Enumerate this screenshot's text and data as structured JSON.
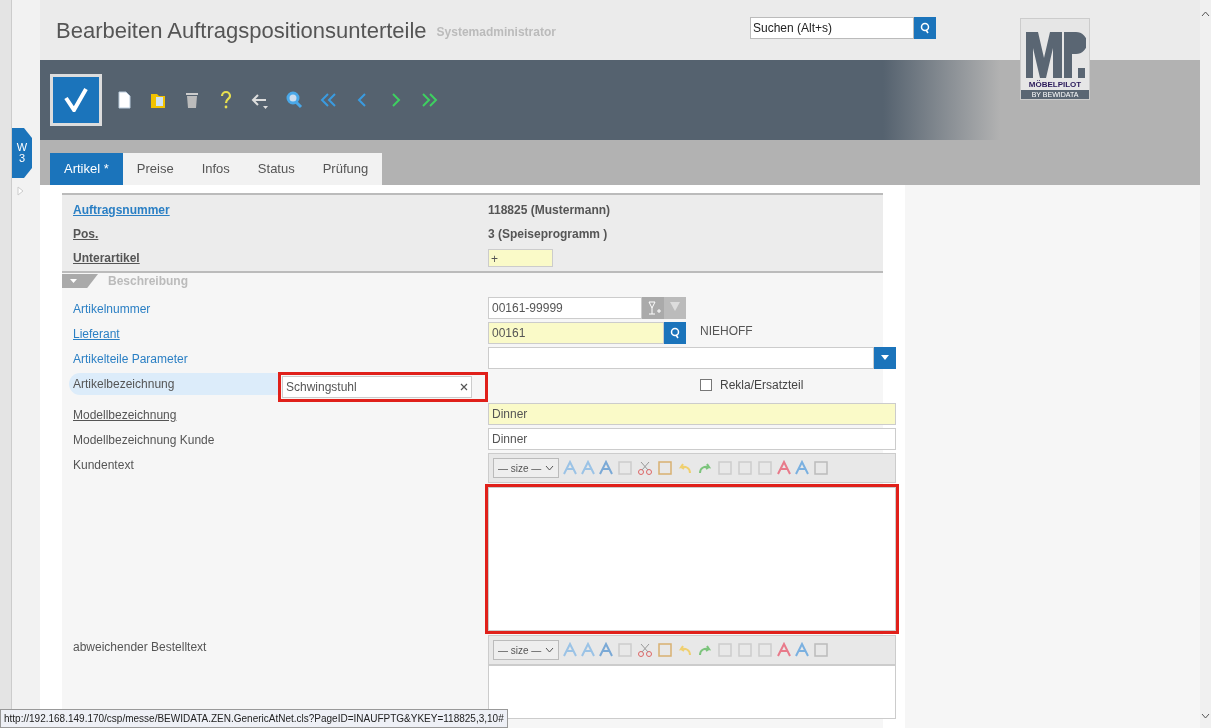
{
  "header": {
    "title": "Bearbeiten Auftragspositionsunterteile",
    "user": "Systemadministrator",
    "search": {
      "placeholder": "Suchen (Alt+s)"
    },
    "logo": {
      "brand": "MÖBELPILOT",
      "sub": "BY BEWIDATA"
    }
  },
  "side_tab": {
    "label": "W 3"
  },
  "tabs": [
    {
      "label": "Artikel *",
      "selected": true
    },
    {
      "label": "Preise",
      "selected": false
    },
    {
      "label": "Infos",
      "selected": false
    },
    {
      "label": "Status",
      "selected": false
    },
    {
      "label": "Prüfung",
      "selected": false
    }
  ],
  "summary": [
    {
      "label": "Auftragsnummer",
      "link": true,
      "value": "118825 (Mustermann)",
      "kind": "text"
    },
    {
      "label": "Pos.",
      "link": false,
      "value": "3 (Speiseprogramm )",
      "kind": "text"
    },
    {
      "label": "Unterartikel",
      "link": false,
      "value": "+",
      "kind": "input"
    }
  ],
  "section": {
    "title": "Beschreibung",
    "expanded": true
  },
  "fields": [
    {
      "label": "Artikelnummer",
      "color": "#2a7fc4",
      "underlined": false,
      "focused": false,
      "kind": "article",
      "value": "00161-99999"
    },
    {
      "label": "Lieferant",
      "color": "#2a7fc4",
      "underlined": true,
      "focused": false,
      "kind": "lookup",
      "value": "00161",
      "extra": "NIEHOFF"
    },
    {
      "label": "Artikelteile Parameter",
      "color": "#2a7fc4",
      "underlined": false,
      "focused": false,
      "kind": "select"
    },
    {
      "label": "Artikelbezeichnung",
      "color": "#555555",
      "underlined": false,
      "focused": true,
      "kind": "side",
      "value": "Schwingstuhl",
      "highlighted": true,
      "checkbox": {
        "label": "Rekla/Ersatzteil",
        "checked": false
      }
    },
    {
      "label": "Modellbezeichnung",
      "color": "#555555",
      "underlined": true,
      "focused": false,
      "kind": "required",
      "value": "Dinner"
    },
    {
      "label": "Modellbezeichnung Kunde",
      "color": "#555555",
      "underlined": false,
      "focused": false,
      "kind": "input",
      "value": "Dinner"
    },
    {
      "label": "Kundentext",
      "color": "#555555",
      "underlined": false,
      "focused": false,
      "kind": "editor",
      "size_label": "— size —",
      "highlighted": true
    },
    {
      "label": "abweichender Bestelltext",
      "color": "#555555",
      "underlined": false,
      "focused": false,
      "kind": "editor",
      "size_label": "— size —",
      "highlighted": false
    }
  ],
  "status_bar": {
    "url": "http://192.168.149.170/csp/messe/BEWIDATA.ZEN.GenericAtNet.cls?PageID=INAUFPTG&YKEY=118825,3,10#"
  }
}
